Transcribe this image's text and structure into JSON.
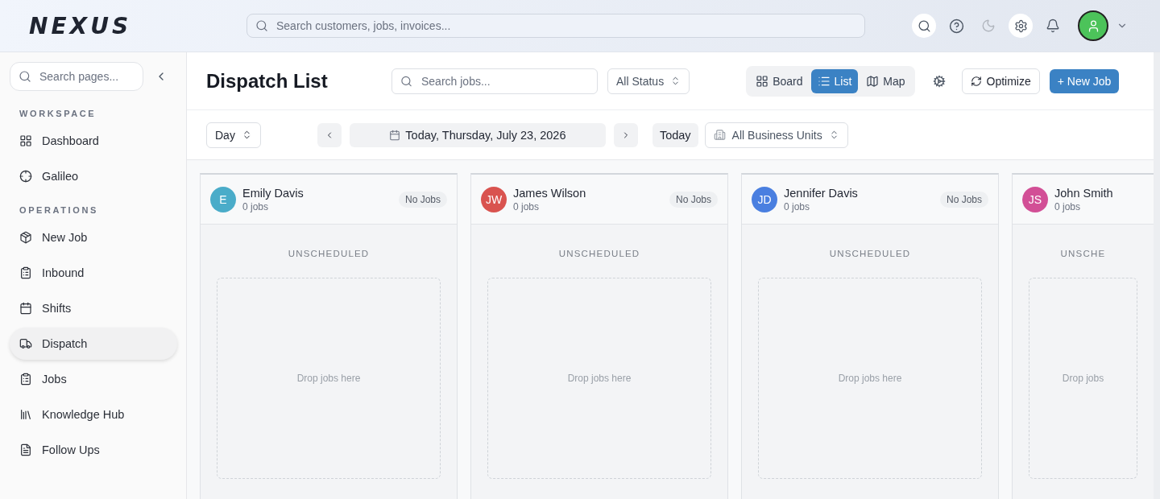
{
  "header": {
    "logo": "NEXUS",
    "search": {
      "placeholder": "Search customers, jobs, invoices..."
    }
  },
  "sidebar": {
    "search": {
      "placeholder": "Search pages..."
    },
    "sections": [
      {
        "title": "WORKSPACE",
        "items": [
          {
            "label": "Dashboard",
            "selected": false
          },
          {
            "label": "Galileo",
            "selected": false
          }
        ]
      },
      {
        "title": "OPERATIONS",
        "items": [
          {
            "label": "New Job",
            "selected": false
          },
          {
            "label": "Inbound",
            "selected": false
          },
          {
            "label": "Shifts",
            "selected": false
          },
          {
            "label": "Dispatch",
            "selected": true
          },
          {
            "label": "Jobs",
            "selected": false
          },
          {
            "label": "Knowledge Hub",
            "selected": false
          },
          {
            "label": "Follow Ups",
            "selected": false
          }
        ]
      }
    ]
  },
  "page": {
    "title": "Dispatch List",
    "search": {
      "placeholder": "Search jobs..."
    },
    "status_filter": "All Status",
    "views": [
      {
        "label": "Board",
        "selected": false
      },
      {
        "label": "List",
        "selected": true
      },
      {
        "label": "Map",
        "selected": false
      }
    ],
    "optimize": "Optimize",
    "new_job": "+ New Job"
  },
  "toolbar": {
    "range": "Day",
    "date": "Today, Thursday, July 23, 2026",
    "today": "Today",
    "business_units": "All Business Units"
  },
  "columns": [
    {
      "initials": "E",
      "name": "Emily Davis",
      "count": "0 jobs",
      "badge": "No Jobs",
      "color": "#4aacc9",
      "section": "UNSCHEDULED",
      "drop": "Drop jobs here"
    },
    {
      "initials": "JW",
      "name": "James Wilson",
      "count": "0 jobs",
      "badge": "No Jobs",
      "color": "#d9534f",
      "section": "UNSCHEDULED",
      "drop": "Drop jobs here"
    },
    {
      "initials": "JD",
      "name": "Jennifer Davis",
      "count": "0 jobs",
      "badge": "No Jobs",
      "color": "#4a7fe0",
      "section": "UNSCHEDULED",
      "drop": "Drop jobs here"
    },
    {
      "initials": "JS",
      "name": "John Smith",
      "count": "0 jobs",
      "color": "#d24f96",
      "section": "UNSCHE",
      "drop": "Drop jobs"
    }
  ]
}
